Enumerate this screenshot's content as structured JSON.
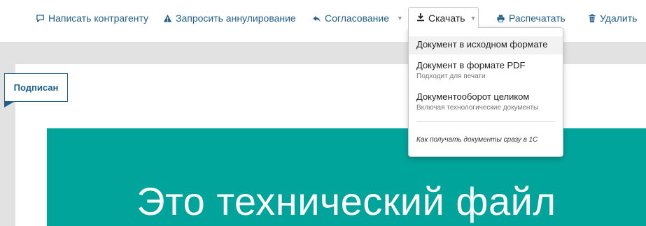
{
  "toolbar": {
    "write": "Написать контрагенту",
    "revoke": "Запросить аннулирование",
    "approval": "Согласование",
    "download": "Скачать",
    "print": "Распечатать",
    "delete": "Удалить"
  },
  "download_menu": {
    "items": [
      {
        "title": "Документ в исходном формате",
        "subtitle": ""
      },
      {
        "title": "Документ в формате PDF",
        "subtitle": "Подходит для печати"
      },
      {
        "title": "Документооборот целиком",
        "subtitle": "Включая технологические документы"
      }
    ],
    "link": "Как получать документы сразу в 1С"
  },
  "document": {
    "status": "Подписан",
    "preview_text": "Это технический файл"
  },
  "colors": {
    "accent": "#1f5f8b",
    "preview_bg": "#00a49a",
    "viewer_bg": "#e2e2e2"
  },
  "icons": {
    "write": "comment-icon",
    "revoke": "warning-icon",
    "approval": "reply-arrow-icon",
    "download": "download-icon",
    "print": "printer-icon",
    "delete": "trash-icon"
  }
}
